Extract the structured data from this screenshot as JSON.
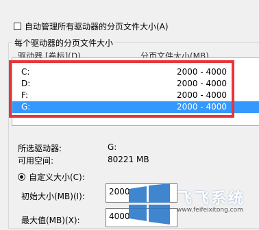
{
  "auto_manage": {
    "label": "自动管理所有驱动器的分页文件大小(A)",
    "checked": false
  },
  "group": {
    "title": "每个驱动器的分页文件大小"
  },
  "list": {
    "columns": [
      "驱动器 [卷标](D)",
      "分页文件大小(MB)"
    ],
    "rows": [
      {
        "drive": "C:",
        "size": "2000 - 4000",
        "selected": false
      },
      {
        "drive": "D:",
        "size": "2000 - 4000",
        "selected": false
      },
      {
        "drive": "F:",
        "size": "2000 - 4000",
        "selected": false
      },
      {
        "drive": "G:",
        "size": "2000 - 4000",
        "selected": true
      }
    ]
  },
  "info": {
    "selected_drive_label": "所选驱动器:",
    "selected_drive_value": "G:",
    "free_space_label": "可用空间:",
    "free_space_value": "80221 MB"
  },
  "custom": {
    "radio_label": "自定义大小(C):",
    "initial_label": "初始大小(MB)(I):",
    "initial_value": "2000",
    "max_label": "最大值(MB)(X):",
    "max_value": "4000"
  },
  "watermark": {
    "brand": "飞飞系统",
    "url": "www.feifeixitong.com"
  },
  "colors": {
    "selection": "#3399ff",
    "highlight_box": "#e8353a"
  }
}
